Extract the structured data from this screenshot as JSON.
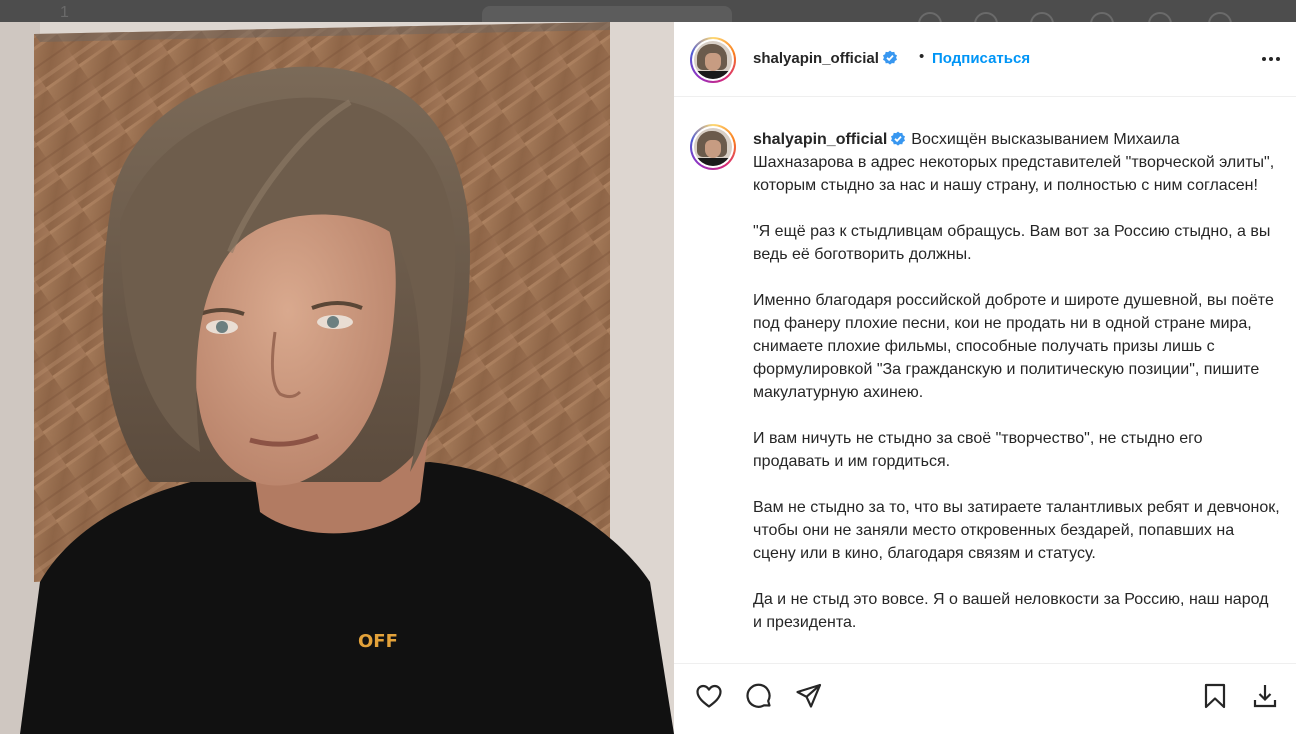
{
  "post": {
    "username": "shalyapin_official",
    "verified": true,
    "separator": "•",
    "follow_label": "Подписаться"
  },
  "caption": {
    "username": "shalyapin_official",
    "paragraphs": [
      "Восхищён высказыванием Михаила Шахназарова в адрес некоторых представителей \"творческой элиты\", которым стыдно за нас и нашу страну, и полностью с ним согласен!",
      "\"Я ещё раз к стыдливцам обращусь. Вам вот за Россию стыдно, а вы ведь её боготворить должны.",
      "Именно благодаря российской доброте и широте душевной, вы поёте под фанеру плохие песни, кои не продать ни в одной стране мира, снимаете плохие фильмы, способные получать призы лишь с формулировкой \"За гражданскую и политическую позиции\", пишите макулатурную ахинею.",
      "И вам ничуть не стыдно за своё \"творчество\", не стыдно его продавать и им гордиться.",
      "Вам не стыдно за то, что вы затираете талантливых ребят и девчонок, чтобы они не заняли место откровенных бездарей, попавших на сцену или в кино, благодаря связям и статусу.",
      "Да и не стыд это вовсе. Я о вашей неловкости за Россию, наш народ и президента."
    ]
  },
  "photo": {
    "shirt_print": "OFF"
  },
  "icons": {
    "like": "heart-icon",
    "comment": "comment-icon",
    "share": "share-icon",
    "save": "bookmark-icon",
    "download": "download-icon",
    "more": "more-options-icon",
    "verified": "verified-badge-icon"
  },
  "colors": {
    "accent": "#0095f6",
    "verified": "#3897f0",
    "text": "#262626"
  }
}
